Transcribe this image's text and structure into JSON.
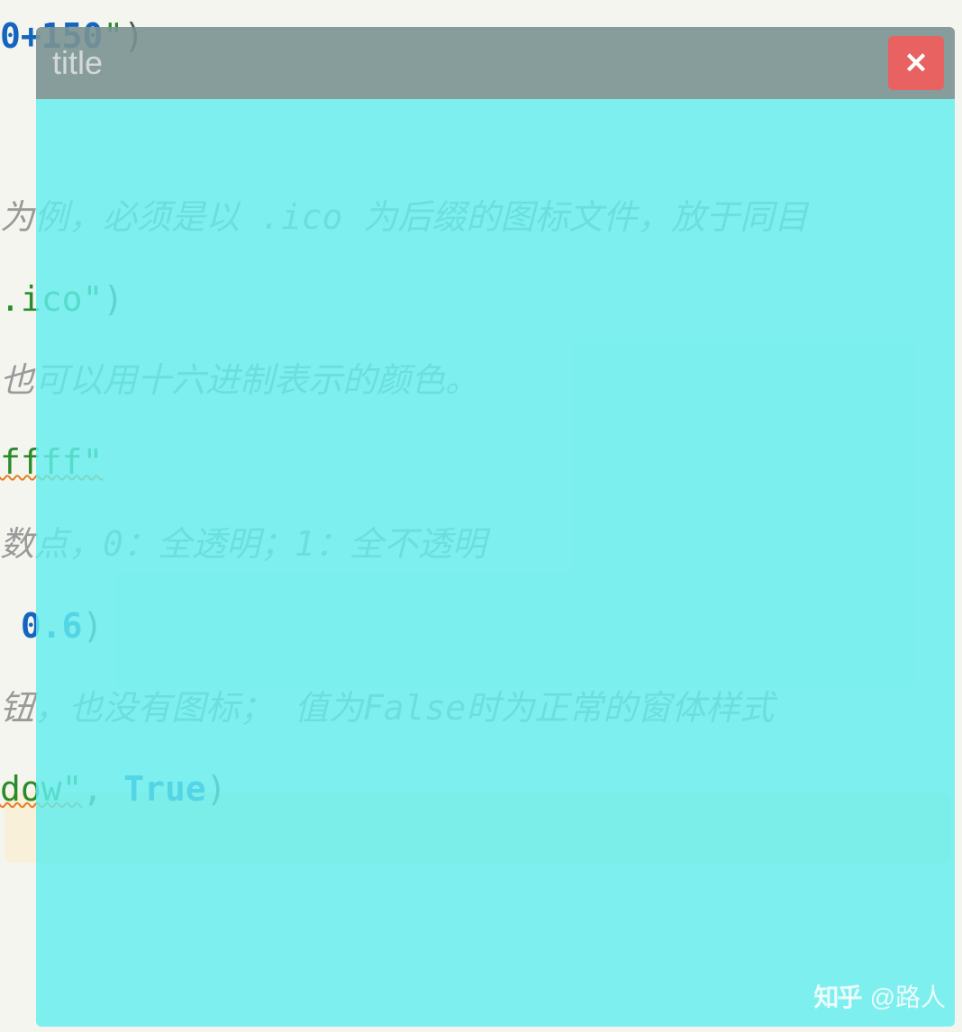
{
  "code": {
    "line1_part1": "0+150",
    "line1_quote": "\"",
    "line1_paren": ")",
    "line2_comment": "为例，必须是以 .ico 为后缀的图标文件，放于同目",
    "line3_str": ".ico\"",
    "line3_paren": ")",
    "line4_comment": "也可以用十六进制表示的颜色。",
    "line5_str": "ffff\"",
    "line6_comment": "数点，0：全透明；1：全不透明",
    "line7_num": "0.6",
    "line7_paren": ")",
    "line8_comment": "钮，也没有图标；  值为False时为正常的窗体样式",
    "line9_str1": "dow\"",
    "line9_comma": ", ",
    "line9_bool": "True",
    "line9_paren": ")"
  },
  "window": {
    "title": "title"
  },
  "watermark": {
    "brand": "知乎",
    "user": "@路人"
  }
}
